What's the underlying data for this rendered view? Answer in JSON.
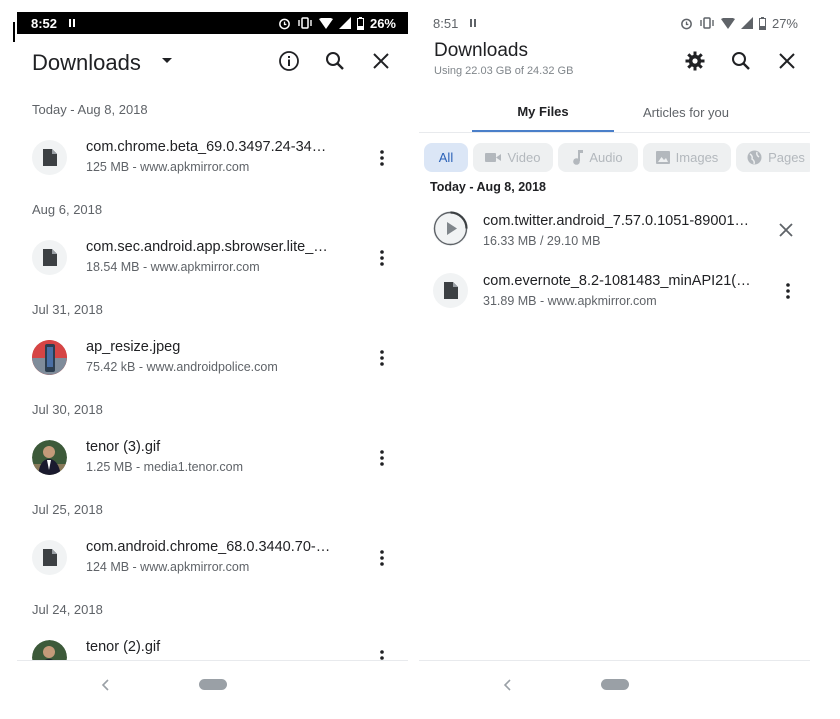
{
  "left_screen": {
    "status": {
      "time": "8:52",
      "battery": "26%"
    },
    "title": "Downloads",
    "groups": [
      {
        "date": "Today - Aug 8, 2018",
        "item": {
          "title": "com.chrome.beta_69.0.3497.24-34…",
          "subtitle": "125 MB - www.apkmirror.com",
          "icon": "file-icon"
        }
      },
      {
        "date": "Aug 6, 2018",
        "item": {
          "title": "com.sec.android.app.sbrowser.lite_…",
          "subtitle": "18.54 MB - www.apkmirror.com",
          "icon": "file-icon"
        }
      },
      {
        "date": "Jul 31, 2018",
        "item": {
          "title": "ap_resize.jpeg",
          "subtitle": "75.42 kB - www.androidpolice.com",
          "icon": "image-thumbnail"
        }
      },
      {
        "date": "Jul 30, 2018",
        "item": {
          "title": "tenor (3).gif",
          "subtitle": "1.25 MB - media1.tenor.com",
          "icon": "gif-thumbnail"
        }
      },
      {
        "date": "Jul 25, 2018",
        "item": {
          "title": "com.android.chrome_68.0.3440.70-…",
          "subtitle": "124 MB - www.apkmirror.com",
          "icon": "file-icon"
        }
      },
      {
        "date": "Jul 24, 2018",
        "item": {
          "title": "tenor (2).gif",
          "subtitle": "",
          "icon": "gif-thumbnail"
        }
      }
    ]
  },
  "right_screen": {
    "status": {
      "time": "8:51",
      "battery": "27%"
    },
    "title": "Downloads",
    "subtitle": "Using 22.03 GB of 24.32 GB",
    "tabs": [
      "My Files",
      "Articles for you"
    ],
    "chips": [
      "All",
      "Video",
      "Audio",
      "Images",
      "Pages"
    ],
    "date": "Today - Aug 8, 2018",
    "items": [
      {
        "title": "com.twitter.android_7.57.0.1051-89001…",
        "subtitle": "16.33 MB / 29.10 MB",
        "icon": "play-icon",
        "action": "close-icon"
      },
      {
        "title": "com.evernote_8.2-1081483_minAPI21(…",
        "subtitle": "31.89 MB - www.apkmirror.com",
        "icon": "file-icon",
        "action": "more-vert-icon"
      }
    ]
  },
  "colors": {
    "accent": "#4a7fc9",
    "chip_active_bg": "#dbe6f6",
    "chip_active_text": "#2b62b8",
    "secondary_text": "#5f6368"
  }
}
